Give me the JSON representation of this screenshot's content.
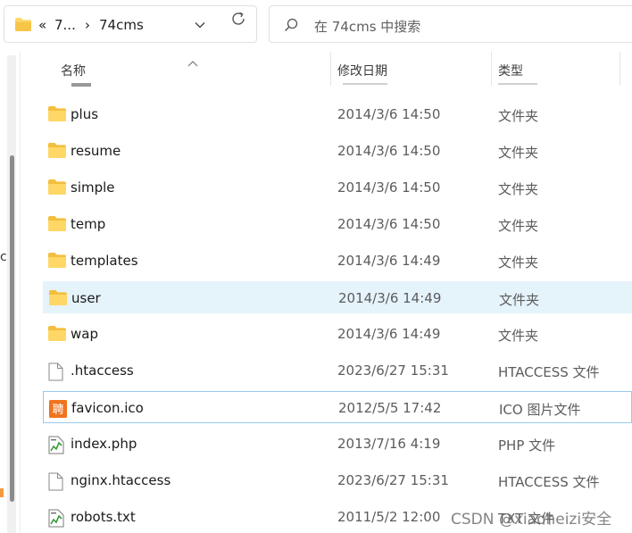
{
  "address_bar": {
    "overflow_glyph": "«",
    "parent_segment": "7...",
    "separator": "›",
    "current_segment": "74cms"
  },
  "search": {
    "placeholder": "在 74cms 中搜索"
  },
  "left_nav": {
    "clipped_text": "c"
  },
  "columns": {
    "name": "名称",
    "modified": "修改日期",
    "type": "类型"
  },
  "files": [
    {
      "name": "plus",
      "modified": "2014/3/6 14:50",
      "type": "文件夹",
      "icon": "folder-icon"
    },
    {
      "name": "resume",
      "modified": "2014/3/6 14:50",
      "type": "文件夹",
      "icon": "folder-icon"
    },
    {
      "name": "simple",
      "modified": "2014/3/6 14:50",
      "type": "文件夹",
      "icon": "folder-icon"
    },
    {
      "name": "temp",
      "modified": "2014/3/6 14:50",
      "type": "文件夹",
      "icon": "folder-icon"
    },
    {
      "name": "templates",
      "modified": "2014/3/6 14:49",
      "type": "文件夹",
      "icon": "folder-icon"
    },
    {
      "name": "user",
      "modified": "2014/3/6 14:49",
      "type": "文件夹",
      "icon": "folder-icon",
      "state": "selected"
    },
    {
      "name": "wap",
      "modified": "2014/3/6 14:49",
      "type": "文件夹",
      "icon": "folder-icon"
    },
    {
      "name": ".htaccess",
      "modified": "2023/6/27 15:31",
      "type": "HTACCESS 文件",
      "icon": "blank-file-icon"
    },
    {
      "name": "favicon.ico",
      "modified": "2012/5/5 17:42",
      "type": "ICO 图片文件",
      "icon": "ico-image-icon",
      "state": "focused"
    },
    {
      "name": "index.php",
      "modified": "2013/7/16 4:19",
      "type": "PHP 文件",
      "icon": "script-file-icon"
    },
    {
      "name": "nginx.htaccess",
      "modified": "2023/6/27 15:31",
      "type": "HTACCESS 文件",
      "icon": "blank-file-icon"
    },
    {
      "name": "robots.txt",
      "modified": "2011/5/2 12:00",
      "type": "TXT 文件",
      "icon": "script-file-icon"
    }
  ],
  "watermark": "CSDN @xiaoheizi安全",
  "colors": {
    "folder": "#ffd766",
    "folder_dark": "#f0b83a",
    "selected_bg": "#e5f3fb",
    "focus_border": "#99c9ef",
    "ico_accent": "#f0741e"
  }
}
